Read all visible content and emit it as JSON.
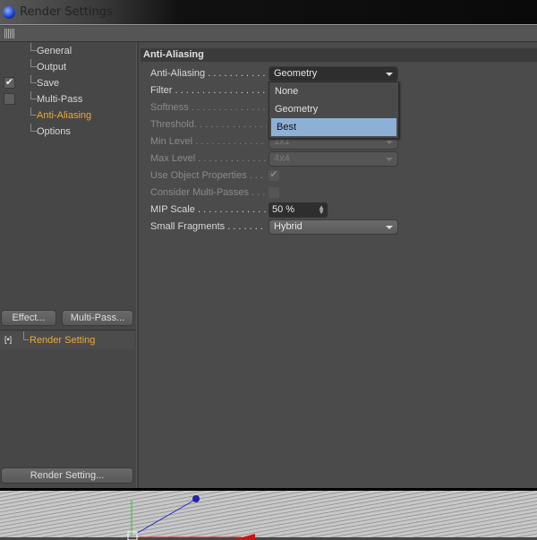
{
  "window": {
    "title": "Render Settings"
  },
  "tree": [
    {
      "label": "General",
      "checkbox": null,
      "active": false
    },
    {
      "label": "Output",
      "checkbox": null,
      "active": false
    },
    {
      "label": "Save",
      "checkbox": true,
      "active": false
    },
    {
      "label": "Multi-Pass",
      "checkbox": false,
      "active": false
    },
    {
      "label": "Anti-Aliasing",
      "checkbox": null,
      "active": true
    },
    {
      "label": "Options",
      "checkbox": null,
      "active": false
    }
  ],
  "buttons": {
    "effect": "Effect...",
    "multipass": "Multi-Pass...",
    "render_setting": "Render Setting..."
  },
  "settings_list": {
    "item": "Render Setting"
  },
  "section": {
    "title": "Anti-Aliasing"
  },
  "fields": {
    "anti_aliasing": {
      "label": "Anti-Aliasing . . . . . . . . . . .",
      "value": "Geometry"
    },
    "filter": {
      "label": "Filter . . . . . . . . . . . . . . . . . . . ."
    },
    "softness": {
      "label": "Softness . . . . . . . . . . . . . . . ."
    },
    "threshold": {
      "label": "Threshold. . . . . . . . . . . . . . ."
    },
    "min_level": {
      "label": "Min Level . . . . . . . . . . . . . .",
      "value": "1x1"
    },
    "max_level": {
      "label": "Max Level . . . . . . . . . . . . . .",
      "value": "4x4"
    },
    "use_object_properties": {
      "label": "Use Object Properties . . .",
      "checked": true
    },
    "consider_multipasses": {
      "label": "Consider Multi-Passes . . .",
      "checked": false
    },
    "mip_scale": {
      "label": "MIP Scale . . . . . . . . . . . . . . .",
      "value": "50 %"
    },
    "small_fragments": {
      "label": "Small Fragments . . . . . . .",
      "value": "Hybrid"
    }
  },
  "dropdown_menu": {
    "options": [
      "None",
      "Geometry",
      "Best"
    ],
    "highlighted": "Best"
  },
  "colors": {
    "accent": "#f0a830",
    "highlight": "#8fb0d6"
  }
}
